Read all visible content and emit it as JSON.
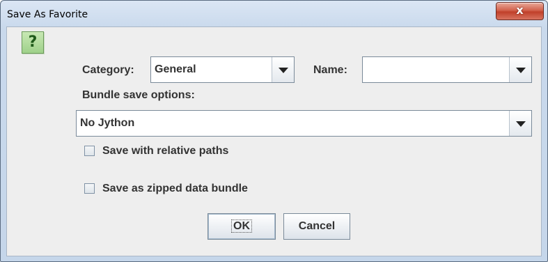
{
  "window": {
    "title": "Save As Favorite",
    "close_label": "x"
  },
  "help_icon": {
    "glyph": "?"
  },
  "category": {
    "label": "Category:",
    "value": "General"
  },
  "name": {
    "label": "Name:",
    "value": ""
  },
  "bundle": {
    "label": "Bundle save options:",
    "value": "No Jython"
  },
  "options": [
    {
      "label": "Save with relative paths",
      "checked": false
    },
    {
      "label": "Save as zipped data bundle",
      "checked": false
    }
  ],
  "buttons": {
    "ok": "OK",
    "cancel": "Cancel"
  },
  "colors": {
    "close_button": "#c9503b",
    "help_icon": "#9fd18a",
    "panel": "#eeeeee"
  }
}
